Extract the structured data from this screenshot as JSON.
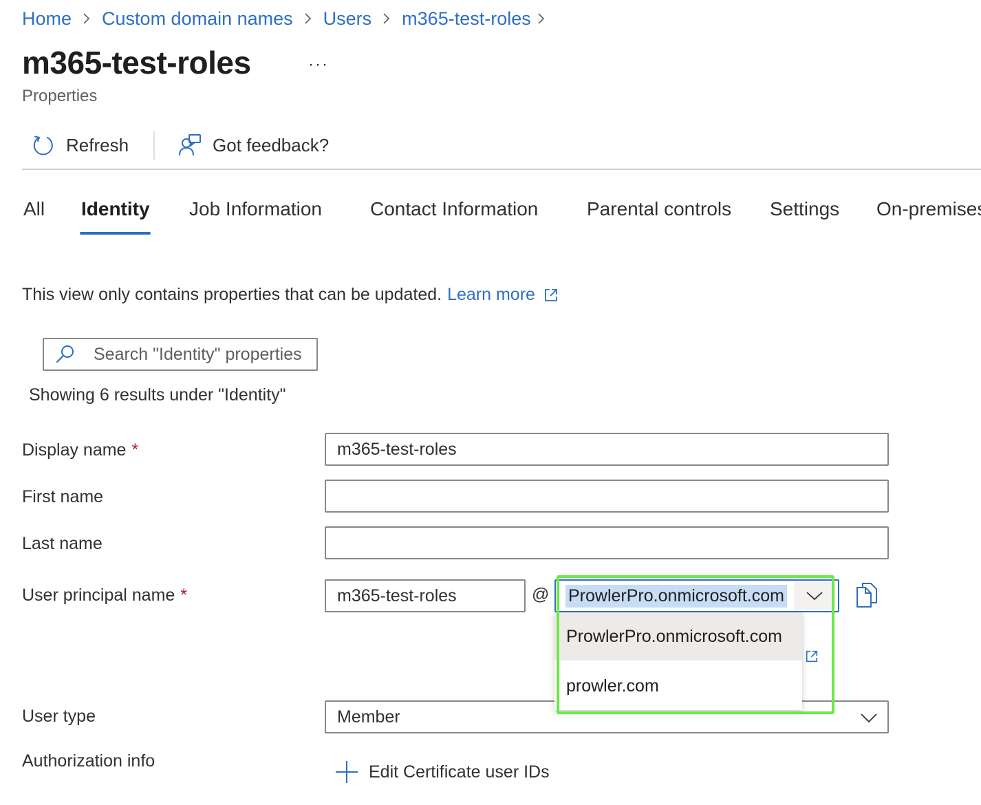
{
  "breadcrumb": {
    "items": [
      "Home",
      "Custom domain names",
      "Users",
      "m365-test-roles"
    ]
  },
  "page": {
    "title": "m365-test-roles",
    "more_label": "···",
    "subtitle": "Properties"
  },
  "toolbar": {
    "refresh_label": "Refresh",
    "feedback_label": "Got feedback?"
  },
  "tabs": {
    "items": [
      "All",
      "Identity",
      "Job Information",
      "Contact Information",
      "Parental controls",
      "Settings",
      "On-premises"
    ],
    "active": "Identity"
  },
  "info": {
    "text": "This view only contains properties that can be updated.",
    "learn_more": "Learn more"
  },
  "search": {
    "placeholder": "Search \"Identity\" properties"
  },
  "results_text": "Showing 6 results under \"Identity\"",
  "form": {
    "display_name": {
      "label": "Display name",
      "required_mark": "*",
      "value": "m365-test-roles"
    },
    "first_name": {
      "label": "First name",
      "value": ""
    },
    "last_name": {
      "label": "Last name",
      "value": ""
    },
    "upn": {
      "label": "User principal name",
      "required_mark": "*",
      "local_value": "m365-test-roles",
      "at_sign": "@",
      "domain_value": "ProwlerPro.onmicrosoft.com",
      "domain_options": [
        "ProwlerPro.onmicrosoft.com",
        "prowler.com"
      ]
    },
    "user_type": {
      "label": "User type",
      "value": "Member"
    },
    "authorization_info": {
      "label": "Authorization info",
      "action_label": "Edit Certificate user IDs"
    }
  },
  "colors": {
    "accent": "#2f6fc1",
    "required": "#a4262c",
    "highlight": "#6ee84a",
    "selection": "#c7dcf5"
  },
  "icons": [
    "chevron-right-icon",
    "refresh-icon",
    "feedback-icon",
    "external-link-icon",
    "search-icon",
    "chevron-down-icon",
    "copy-icon",
    "plus-icon"
  ]
}
